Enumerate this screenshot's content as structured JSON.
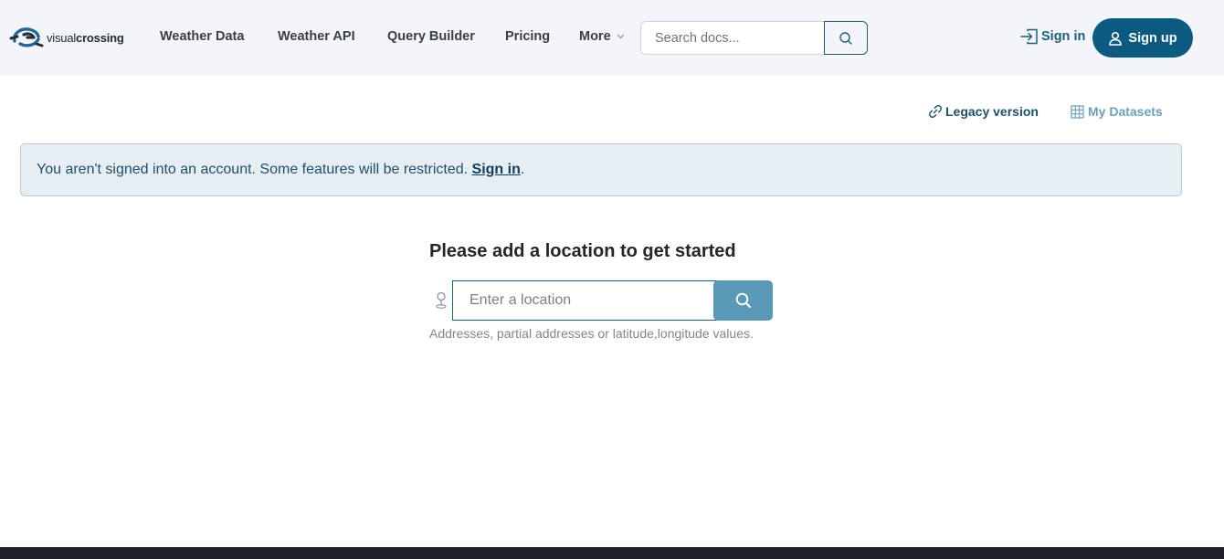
{
  "header": {
    "logo": {
      "light": "visual",
      "bold": "crossing"
    },
    "nav": [
      {
        "label": "Weather Data"
      },
      {
        "label": "Weather API"
      },
      {
        "label": "Query Builder"
      },
      {
        "label": "Pricing"
      },
      {
        "label": "More"
      }
    ],
    "search": {
      "placeholder": "Search docs..."
    },
    "sign_in": "Sign in",
    "sign_up": "Sign up"
  },
  "sublinks": {
    "legacy": "Legacy version",
    "datasets": "My Datasets"
  },
  "alert": {
    "text": "You aren't signed into an account. Some features will be restricted.",
    "link": "Sign in",
    "suffix": "."
  },
  "main": {
    "heading": "Please add a location to get started",
    "location_placeholder": "Enter a location",
    "hint": "Addresses, partial addresses or latitude,longitude values."
  },
  "colors": {
    "brand": "#0c5a80",
    "accent_button": "#5a98b8",
    "alert_bg": "#e6eef3",
    "header_bg": "#f4f5f8"
  },
  "icons": [
    "logo-icon",
    "chevron-down-icon",
    "search-icon",
    "sign-in-icon",
    "user-icon",
    "link-icon",
    "grid-icon",
    "location-pin-icon"
  ]
}
